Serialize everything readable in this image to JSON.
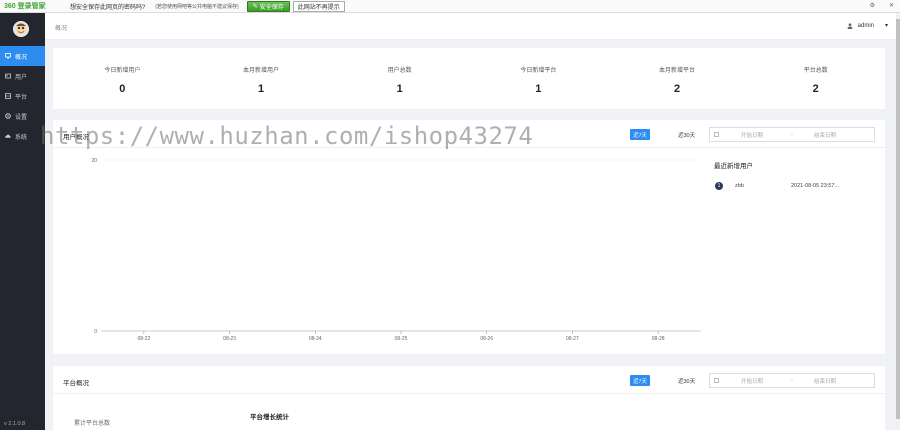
{
  "password_bar": {
    "brand": "360 登录管家",
    "question": "想安全保存此网页的密码吗?",
    "note": "(若您使用网吧等公共电脑不建议保存)",
    "save_label": "安全保存",
    "no_prompt_label": "此网站不再提示",
    "settings_glyph": "⚙",
    "close_glyph": "✕"
  },
  "sidebar": {
    "items": [
      {
        "label": "概况",
        "icon": "monitor-icon",
        "active": true
      },
      {
        "label": "用户",
        "icon": "user-card-icon",
        "active": false
      },
      {
        "label": "平台",
        "icon": "grid-icon",
        "active": false
      },
      {
        "label": "设置",
        "icon": "gear-icon",
        "active": false
      },
      {
        "label": "系统",
        "icon": "cloud-icon",
        "active": false
      }
    ],
    "version": "v 2.1.0.8"
  },
  "header": {
    "breadcrumb": "概况",
    "username": "admin",
    "dropdown_glyph": "▾"
  },
  "stats": [
    {
      "label": "今日新增用户",
      "value": "0"
    },
    {
      "label": "本月新增用户",
      "value": "1"
    },
    {
      "label": "用户总数",
      "value": "1"
    },
    {
      "label": "今日新增平台",
      "value": "1"
    },
    {
      "label": "本月新增平台",
      "value": "2"
    },
    {
      "label": "平台总数",
      "value": "2"
    }
  ],
  "user_panel": {
    "title": "用户概况",
    "btn_7days": "近7天",
    "btn_30days": "近30天",
    "date_start": "开始日期",
    "date_sep": "-",
    "date_end": "结束日期",
    "recent_title": "最近新增用户",
    "recent": [
      {
        "rank": "1",
        "name": "zbb",
        "time": "2021-08-05 23:57..."
      }
    ]
  },
  "platform_panel": {
    "title": "平台概况",
    "btn_7days": "近7天",
    "btn_30days": "近30天",
    "date_start": "开始日期",
    "date_sep": "-",
    "date_end": "结束日期",
    "total_label": "累计平台总数",
    "growth_title": "平台增长统计"
  },
  "watermark": "https://www.huzhan.com/ishop43274",
  "chart_data": {
    "type": "line",
    "categories": [
      "08-22",
      "08-23",
      "08-24",
      "08-25",
      "08-26",
      "08-27",
      "08-28"
    ],
    "series": [
      {
        "values": [
          0,
          0,
          0,
          0,
          0,
          0,
          0
        ]
      }
    ],
    "ylim": [
      0,
      20
    ],
    "yticks": [
      "20",
      "0"
    ],
    "grid": true
  },
  "colors": {
    "accent": "#2d8cf0",
    "sidebar_bg": "#23262e",
    "page_bg": "#f0f2f5"
  }
}
